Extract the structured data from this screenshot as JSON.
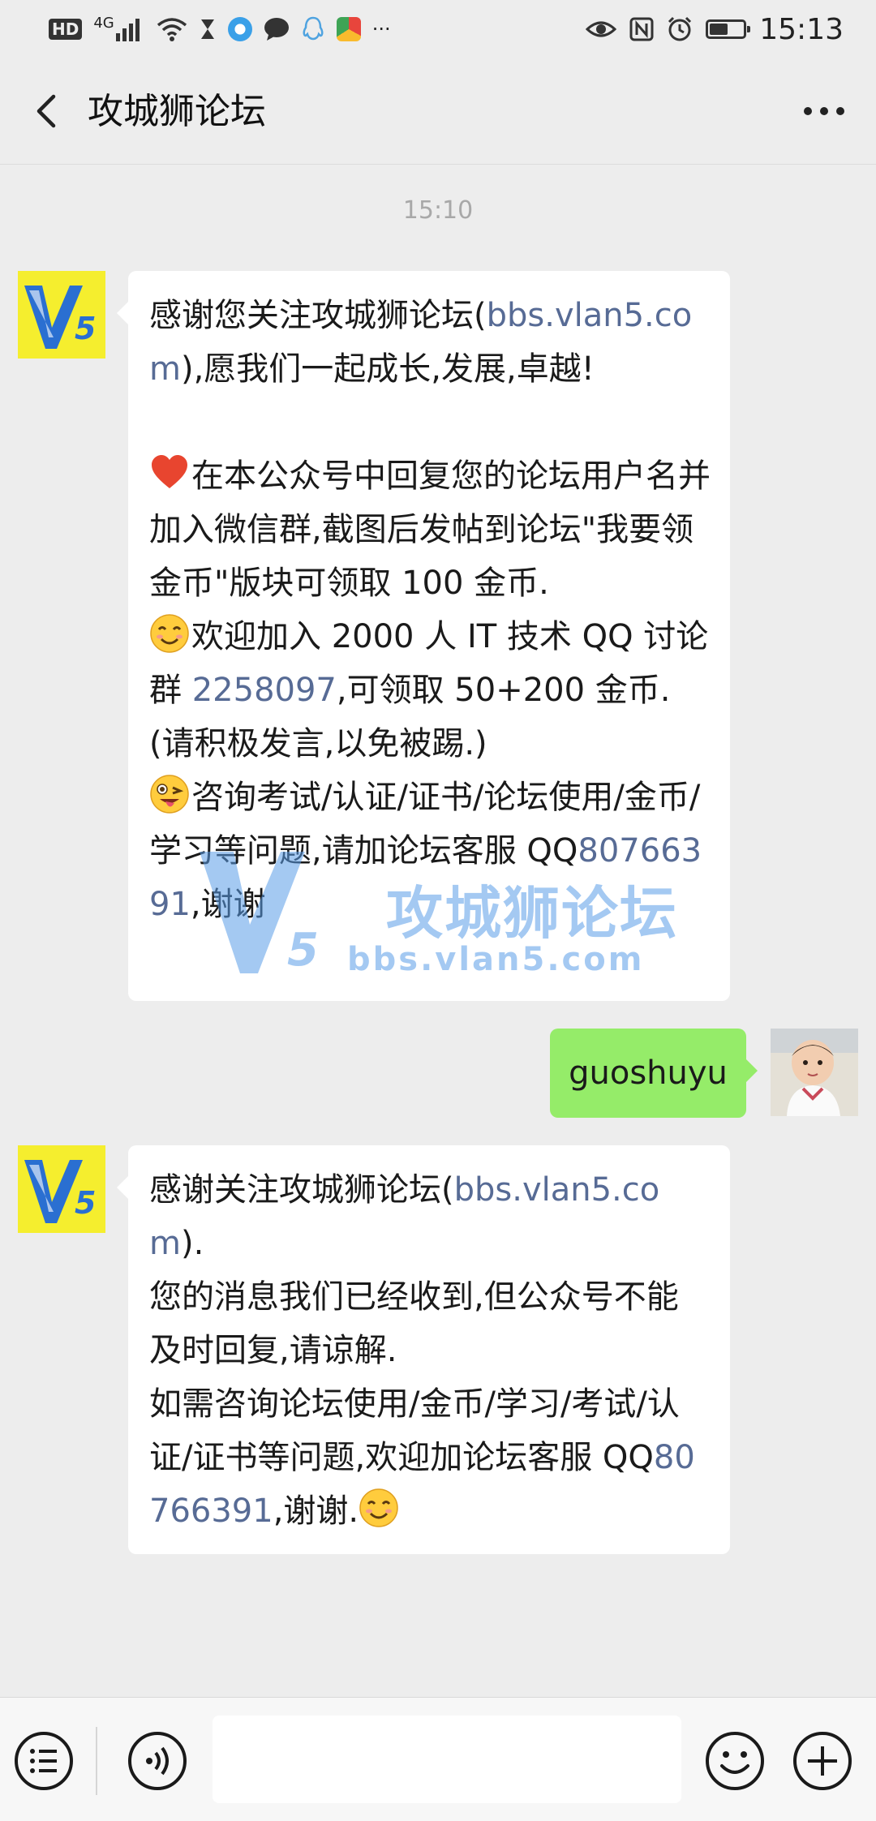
{
  "status_bar": {
    "network_label": "HD",
    "signal_label": "4G",
    "time": "15:13",
    "battery_level": 0.55,
    "more_notifications": "···"
  },
  "header": {
    "title": "攻城狮论坛",
    "back_icon": "chevron-left-icon",
    "more_icon": "more-dots-icon"
  },
  "chat": {
    "timestamp": "15:10",
    "messages": [
      {
        "sender": "bot",
        "avatar_text": "V5",
        "segments": [
          {
            "t": "感谢您关注攻城狮论坛("
          },
          {
            "t": "bbs.vlan5.com",
            "link": true
          },
          {
            "t": "),愿我们一起成长,发展,卓越!\n\n"
          },
          {
            "emoji": "heart"
          },
          {
            "t": "在本公众号中回复您的论坛用户名并加入微信群,截图后发帖到论坛\"我要领金币\"版块可领取 100 金币.\n"
          },
          {
            "emoji": "smile"
          },
          {
            "t": "欢迎加入 2000 人 IT 技术 QQ 讨论群 "
          },
          {
            "t": "2258097",
            "link": true
          },
          {
            "t": ",可领取 50+200 金币.(请积极发言,以免被踢.)\n"
          },
          {
            "emoji": "wink"
          },
          {
            "t": "咨询考试/认证/证书/论坛使用/金币/学习等问题,请加论坛客服 QQ"
          },
          {
            "t": "80766391",
            "link": true
          },
          {
            "t": ",谢谢"
          }
        ]
      },
      {
        "sender": "user",
        "text": "guoshuyu"
      },
      {
        "sender": "bot",
        "avatar_text": "V5",
        "segments": [
          {
            "t": "感谢关注攻城狮论坛("
          },
          {
            "t": "bbs.vlan5.com",
            "link": true
          },
          {
            "t": ").\n您的消息我们已经收到,但公众号不能及时回复,请谅解.\n如需咨询论坛使用/金币/学习/考试/认证/证书等问题,欢迎加论坛客服 QQ"
          },
          {
            "t": "80766391",
            "link": true
          },
          {
            "t": ",谢谢."
          },
          {
            "emoji": "smile"
          }
        ]
      }
    ]
  },
  "watermark": {
    "title": "攻城狮论坛",
    "url": "bbs.vlan5.com"
  },
  "input_bar": {
    "menu_icon": "list-menu-icon",
    "voice_icon": "voice-icon",
    "input_value": "",
    "emoji_icon": "emoji-icon",
    "plus_icon": "plus-icon"
  },
  "colors": {
    "link": "#576b95",
    "user_bubble": "#95ec69",
    "bot_bubble": "#ffffff",
    "background": "#ededed"
  }
}
